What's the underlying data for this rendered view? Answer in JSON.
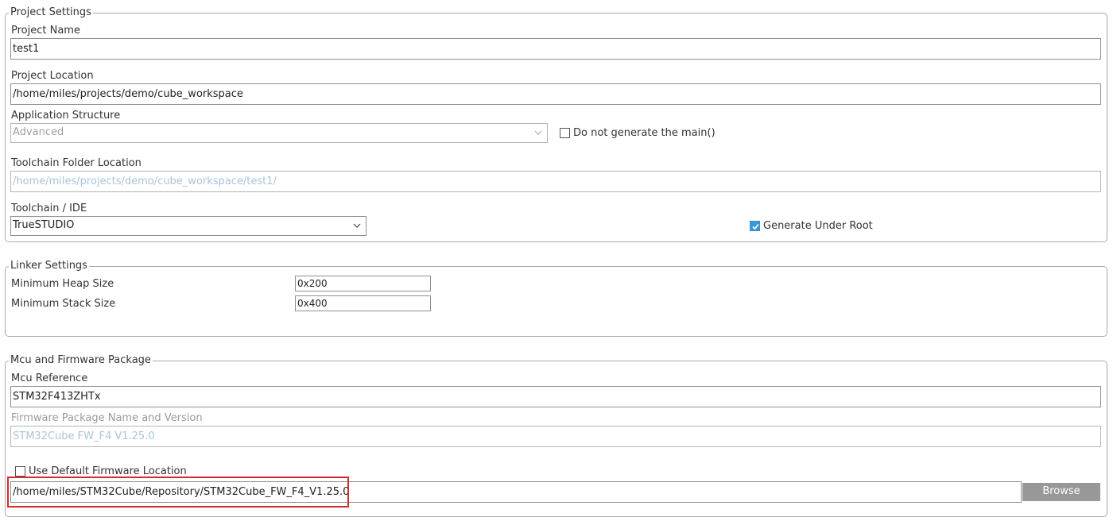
{
  "project_settings": {
    "legend": "Project Settings",
    "project_name_label": "Project Name",
    "project_name_value": "test1",
    "project_location_label": "Project Location",
    "project_location_value": "/home/miles/projects/demo/cube_workspace",
    "app_structure_label": "Application Structure",
    "app_structure_value": "Advanced",
    "no_main_label": "Do not generate the main()",
    "no_main_checked": false,
    "toolchain_folder_label": "Toolchain Folder Location",
    "toolchain_folder_value": "/home/miles/projects/demo/cube_workspace/test1/",
    "toolchain_ide_label": "Toolchain / IDE",
    "toolchain_ide_value": "TrueSTUDIO",
    "generate_under_root_label": "Generate Under Root",
    "generate_under_root_checked": true
  },
  "linker_settings": {
    "legend": "Linker Settings",
    "heap_label": "Minimum Heap Size",
    "heap_value": "0x200",
    "stack_label": "Minimum Stack Size",
    "stack_value": "0x400"
  },
  "mcu_firmware": {
    "legend": "Mcu and Firmware Package",
    "mcu_reference_label": "Mcu Reference",
    "mcu_reference_value": "STM32F413ZHTx",
    "fw_package_label": "Firmware Package Name and Version",
    "fw_package_value": "STM32Cube FW_F4 V1.25.0",
    "use_default_fw_label": "Use Default Firmware Location",
    "use_default_fw_checked": false,
    "fw_location_value": "/home/miles/STM32Cube/Repository/STM32Cube_FW_F4_V1.25.0",
    "browse_label": "Browse"
  },
  "colors": {
    "highlight": "#d42a2a",
    "checkbox_checked": "#3a9ad6",
    "disabled_text": "#a9c4dc",
    "button_bg": "#989898"
  }
}
